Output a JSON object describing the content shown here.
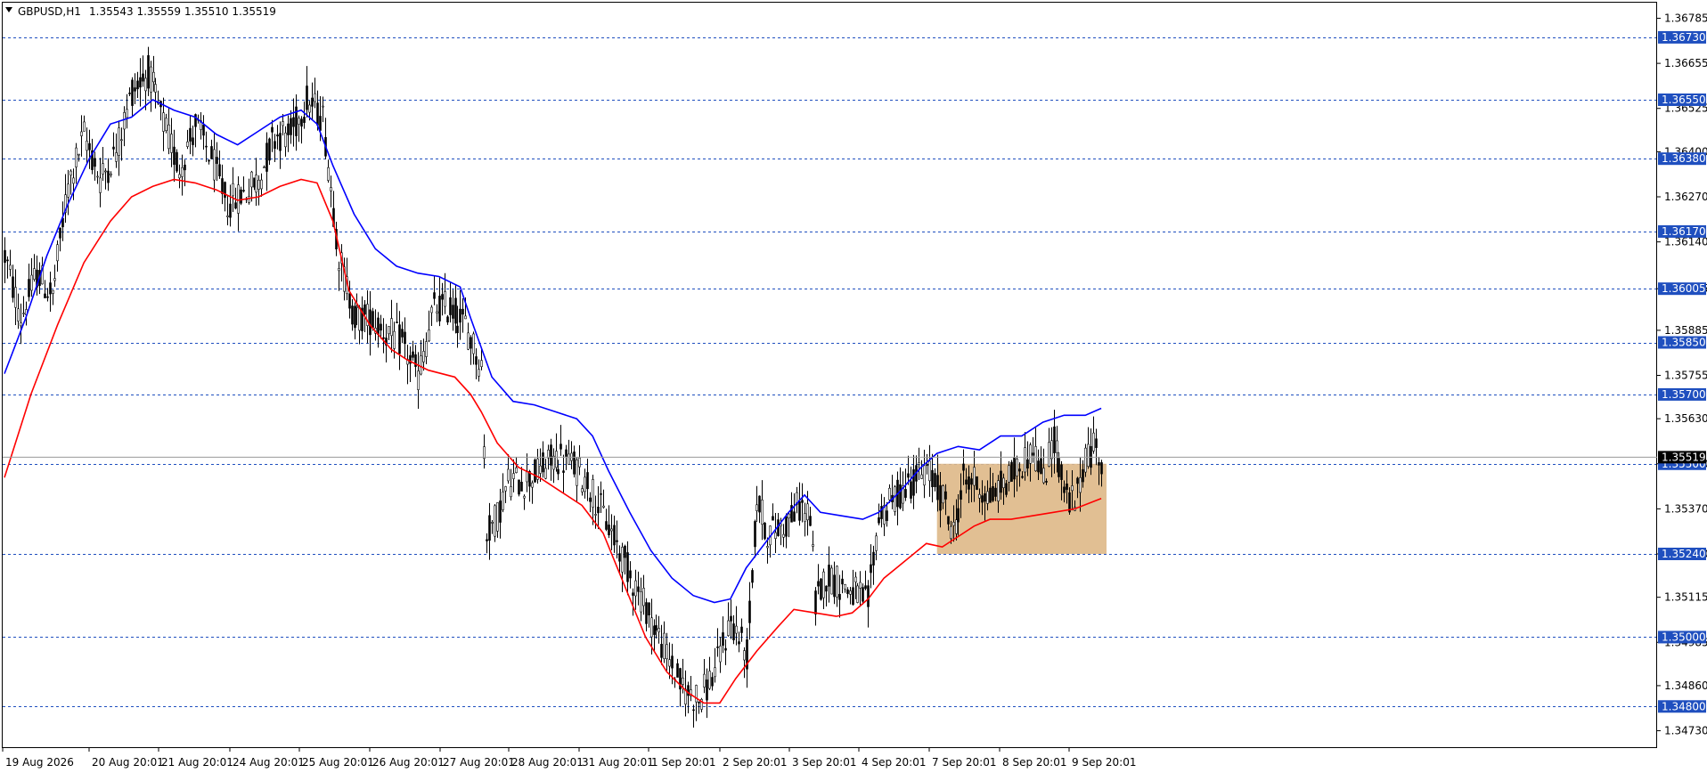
{
  "header": {
    "symbol": "GBPUSD,H1",
    "ohlc": "1.35543 1.35559 1.35510 1.35519"
  },
  "colors": {
    "background": "#ffffff",
    "candle": "#000000",
    "ma_fast": "#0000ff",
    "ma_slow": "#ff0000",
    "level_line": "#1f4fbf",
    "level_label_bg": "#1f4fbf",
    "zone": "#deb887",
    "price_label_bg": "#000000"
  },
  "chart_data": {
    "type": "candlestick",
    "symbol": "GBPUSD",
    "timeframe": "H1",
    "ylim": [
      1.3468,
      1.3683
    ],
    "y_ticks": [
      "1.36785",
      "1.36655",
      "1.36525",
      "1.36400",
      "1.36270",
      "1.36140",
      "1.36005",
      "1.35885",
      "1.35755",
      "1.35630",
      "1.35500",
      "1.35370",
      "1.35240",
      "1.35115",
      "1.34985",
      "1.34860",
      "1.34730"
    ],
    "x_ticks": [
      "19 Aug 2026",
      "20 Aug 20:01",
      "21 Aug 20:01",
      "24 Aug 20:01",
      "25 Aug 20:01",
      "26 Aug 20:01",
      "27 Aug 20:01",
      "28 Aug 20:01",
      "31 Aug 20:01",
      "1 Sep 20:01",
      "2 Sep 20:01",
      "3 Sep 20:01",
      "4 Sep 20:01",
      "7 Sep 20:01",
      "8 Sep 20:01",
      "9 Sep 20:01"
    ],
    "current_price": "1.35519",
    "levels": [
      "1.36730",
      "1.36550",
      "1.36380",
      "1.36170",
      "1.36005",
      "1.35850",
      "1.35700",
      "1.35500",
      "1.35240",
      "1.35000",
      "1.34800"
    ],
    "zone": {
      "start_index": 352,
      "end_index": 416,
      "low": 1.3524,
      "high": 1.355
    },
    "price_path": [
      [
        0,
        1.361
      ],
      [
        6,
        1.3592
      ],
      [
        12,
        1.3605
      ],
      [
        18,
        1.3598
      ],
      [
        24,
        1.363
      ],
      [
        30,
        1.3645
      ],
      [
        36,
        1.3632
      ],
      [
        42,
        1.364
      ],
      [
        48,
        1.3658
      ],
      [
        54,
        1.3663
      ],
      [
        60,
        1.3648
      ],
      [
        66,
        1.3635
      ],
      [
        72,
        1.3648
      ],
      [
        78,
        1.3638
      ],
      [
        84,
        1.3625
      ],
      [
        90,
        1.3628
      ],
      [
        96,
        1.3632
      ],
      [
        102,
        1.3645
      ],
      [
        108,
        1.3645
      ],
      [
        114,
        1.3655
      ],
      [
        120,
        1.365
      ],
      [
        126,
        1.361
      ],
      [
        132,
        1.3592
      ],
      [
        138,
        1.3592
      ],
      [
        144,
        1.3588
      ],
      [
        150,
        1.3585
      ],
      [
        156,
        1.3575
      ],
      [
        162,
        1.3595
      ],
      [
        168,
        1.3595
      ],
      [
        174,
        1.359
      ],
      [
        180,
        1.3578
      ],
      [
        182,
        1.353
      ],
      [
        186,
        1.3535
      ],
      [
        190,
        1.3545
      ],
      [
        196,
        1.3545
      ],
      [
        202,
        1.3548
      ],
      [
        208,
        1.3552
      ],
      [
        214,
        1.355
      ],
      [
        220,
        1.3545
      ],
      [
        226,
        1.3535
      ],
      [
        232,
        1.3525
      ],
      [
        238,
        1.3515
      ],
      [
        244,
        1.3505
      ],
      [
        250,
        1.3495
      ],
      [
        256,
        1.3485
      ],
      [
        262,
        1.3482
      ],
      [
        268,
        1.349
      ],
      [
        274,
        1.3505
      ],
      [
        280,
        1.3495
      ],
      [
        284,
        1.354
      ],
      [
        288,
        1.353
      ],
      [
        294,
        1.3532
      ],
      [
        300,
        1.3538
      ],
      [
        304,
        1.3535
      ],
      [
        306,
        1.351
      ],
      [
        310,
        1.3518
      ],
      [
        316,
        1.3515
      ],
      [
        322,
        1.3512
      ],
      [
        326,
        1.351
      ],
      [
        330,
        1.3535
      ],
      [
        336,
        1.354
      ],
      [
        342,
        1.3545
      ],
      [
        348,
        1.3548
      ],
      [
        354,
        1.354
      ],
      [
        358,
        1.353
      ],
      [
        362,
        1.3545
      ],
      [
        366,
        1.3545
      ],
      [
        372,
        1.354
      ],
      [
        378,
        1.3545
      ],
      [
        384,
        1.355
      ],
      [
        388,
        1.3555
      ],
      [
        392,
        1.3545
      ],
      [
        396,
        1.3558
      ],
      [
        400,
        1.3542
      ],
      [
        404,
        1.3538
      ],
      [
        408,
        1.3552
      ],
      [
        412,
        1.3555
      ],
      [
        414,
        1.3552
      ]
    ],
    "ma_fast_path": [
      [
        0,
        1.3576
      ],
      [
        8,
        1.3592
      ],
      [
        16,
        1.361
      ],
      [
        24,
        1.3625
      ],
      [
        32,
        1.3638
      ],
      [
        40,
        1.3648
      ],
      [
        48,
        1.365
      ],
      [
        56,
        1.3655
      ],
      [
        64,
        1.3652
      ],
      [
        72,
        1.365
      ],
      [
        80,
        1.3645
      ],
      [
        88,
        1.3642
      ],
      [
        96,
        1.3646
      ],
      [
        104,
        1.365
      ],
      [
        112,
        1.3652
      ],
      [
        118,
        1.3648
      ],
      [
        124,
        1.3636
      ],
      [
        132,
        1.3622
      ],
      [
        140,
        1.3612
      ],
      [
        148,
        1.3607
      ],
      [
        156,
        1.3605
      ],
      [
        164,
        1.3604
      ],
      [
        172,
        1.3601
      ],
      [
        176,
        1.3592
      ],
      [
        184,
        1.3575
      ],
      [
        192,
        1.3568
      ],
      [
        200,
        1.3567
      ],
      [
        208,
        1.3565
      ],
      [
        216,
        1.3563
      ],
      [
        222,
        1.3558
      ],
      [
        228,
        1.3548
      ],
      [
        236,
        1.3536
      ],
      [
        244,
        1.3525
      ],
      [
        252,
        1.3517
      ],
      [
        260,
        1.3512
      ],
      [
        268,
        1.351
      ],
      [
        274,
        1.3511
      ],
      [
        280,
        1.352
      ],
      [
        288,
        1.3528
      ],
      [
        296,
        1.3536
      ],
      [
        302,
        1.3541
      ],
      [
        308,
        1.3536
      ],
      [
        316,
        1.3535
      ],
      [
        324,
        1.3534
      ],
      [
        330,
        1.3536
      ],
      [
        338,
        1.3542
      ],
      [
        346,
        1.3549
      ],
      [
        352,
        1.3553
      ],
      [
        360,
        1.3555
      ],
      [
        368,
        1.3554
      ],
      [
        376,
        1.3558
      ],
      [
        384,
        1.3558
      ],
      [
        392,
        1.3562
      ],
      [
        400,
        1.3564
      ],
      [
        408,
        1.3564
      ],
      [
        414,
        1.3566
      ]
    ],
    "ma_slow_path": [
      [
        0,
        1.3546
      ],
      [
        10,
        1.357
      ],
      [
        20,
        1.359
      ],
      [
        30,
        1.3608
      ],
      [
        40,
        1.362
      ],
      [
        48,
        1.3627
      ],
      [
        56,
        1.363
      ],
      [
        64,
        1.3632
      ],
      [
        72,
        1.3631
      ],
      [
        80,
        1.3629
      ],
      [
        88,
        1.3626
      ],
      [
        96,
        1.3627
      ],
      [
        104,
        1.363
      ],
      [
        112,
        1.3632
      ],
      [
        118,
        1.3631
      ],
      [
        124,
        1.362
      ],
      [
        130,
        1.36
      ],
      [
        138,
        1.359
      ],
      [
        146,
        1.3583
      ],
      [
        152,
        1.358
      ],
      [
        160,
        1.3577
      ],
      [
        170,
        1.3575
      ],
      [
        176,
        1.357
      ],
      [
        180,
        1.3565
      ],
      [
        186,
        1.3556
      ],
      [
        194,
        1.3549
      ],
      [
        202,
        1.3546
      ],
      [
        210,
        1.3542
      ],
      [
        218,
        1.3538
      ],
      [
        226,
        1.353
      ],
      [
        234,
        1.3515
      ],
      [
        242,
        1.35
      ],
      [
        250,
        1.349
      ],
      [
        258,
        1.3484
      ],
      [
        264,
        1.3481
      ],
      [
        270,
        1.3481
      ],
      [
        276,
        1.3488
      ],
      [
        284,
        1.3496
      ],
      [
        292,
        1.3503
      ],
      [
        298,
        1.3508
      ],
      [
        306,
        1.3507
      ],
      [
        314,
        1.3506
      ],
      [
        320,
        1.3507
      ],
      [
        326,
        1.3511
      ],
      [
        332,
        1.3517
      ],
      [
        340,
        1.3522
      ],
      [
        348,
        1.3527
      ],
      [
        354,
        1.3526
      ],
      [
        360,
        1.3529
      ],
      [
        366,
        1.3532
      ],
      [
        372,
        1.3534
      ],
      [
        380,
        1.3534
      ],
      [
        388,
        1.3535
      ],
      [
        396,
        1.3536
      ],
      [
        404,
        1.3537
      ],
      [
        414,
        1.354
      ]
    ]
  }
}
